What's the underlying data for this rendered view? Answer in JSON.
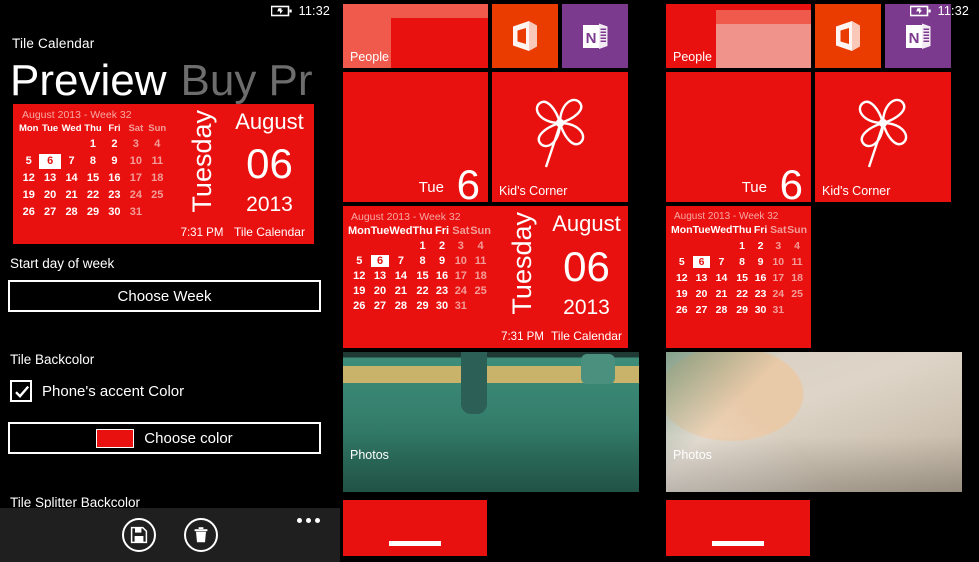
{
  "status_bar": {
    "time": "11:32",
    "battery_icon": "battery-charging-icon"
  },
  "app": {
    "title": "Tile Calendar",
    "pivot": {
      "active": "Preview",
      "inactive": "Buy Pr"
    },
    "settings": {
      "start_day_label": "Start day of week",
      "choose_week_button": "Choose Week",
      "tile_backcolor_label": "Tile Backcolor",
      "accent_checkbox_label": "Phone's accent Color",
      "accent_checked": true,
      "choose_color_button": "Choose color",
      "choose_color_swatch": "#e8110f",
      "tile_splitter_label": "Tile Splitter Backcolor"
    },
    "appbar": {
      "save_icon": "save-floppy-icon",
      "delete_icon": "trash-can-icon",
      "more_icon": "ellipsis-icon"
    }
  },
  "calendar_tile": {
    "month_header": "August 2013 - Week 32",
    "day_names": [
      "Mon",
      "Tue",
      "Wed",
      "Thu",
      "Fri",
      "Sat",
      "Sun"
    ],
    "weekend_indices": [
      5,
      6
    ],
    "weeks": [
      [
        "",
        "",
        "",
        "1",
        "2",
        "3",
        "4"
      ],
      [
        "5",
        "6",
        "7",
        "8",
        "9",
        "10",
        "11"
      ],
      [
        "12",
        "13",
        "14",
        "15",
        "16",
        "17",
        "18"
      ],
      [
        "19",
        "20",
        "21",
        "22",
        "23",
        "24",
        "25"
      ],
      [
        "26",
        "27",
        "28",
        "29",
        "30",
        "31",
        ""
      ]
    ],
    "today": "6",
    "weekday": "Tuesday",
    "time": "7:31 PM",
    "month_name": "August",
    "day_number": "06",
    "year": "2013",
    "app_name": "Tile Calendar",
    "backcolor": "#e8110f"
  },
  "start_screen_1": {
    "tiles": [
      {
        "name": "people",
        "label": "People",
        "color": "#ef5a4d"
      },
      {
        "name": "office",
        "label": "",
        "color": "#ea3c00",
        "icon": "office-logo-icon"
      },
      {
        "name": "onenote",
        "label": "",
        "color": "#7c3a8e",
        "icon": "onenote-logo-icon"
      },
      {
        "name": "calendar-date",
        "label": "",
        "dow": "Tue",
        "day": "6",
        "color": "#e8110f"
      },
      {
        "name": "kids-corner",
        "label": "Kid's Corner",
        "color": "#e8110f",
        "icon": "pinwheel-icon"
      },
      {
        "name": "tile-calendar-live",
        "label": "",
        "color": "#e8110f"
      },
      {
        "name": "photos",
        "label": "Photos",
        "color": "#3f8f7b"
      },
      {
        "name": "partial-red",
        "label": "",
        "color": "#e8110f"
      }
    ]
  },
  "start_screen_2": {
    "tiles": [
      {
        "name": "people",
        "label": "People",
        "color": "#e8110f"
      },
      {
        "name": "office",
        "label": "",
        "color": "#ea3c00",
        "icon": "office-logo-icon"
      },
      {
        "name": "onenote",
        "label": "",
        "color": "#7c3a8e",
        "icon": "onenote-logo-icon"
      },
      {
        "name": "calendar-date",
        "label": "",
        "dow": "Tue",
        "day": "6",
        "color": "#e8110f"
      },
      {
        "name": "kids-corner",
        "label": "Kid's Corner",
        "color": "#e8110f",
        "icon": "pinwheel-icon"
      },
      {
        "name": "tile-calendar-live",
        "label": "",
        "color": "#e8110f"
      },
      {
        "name": "photos",
        "label": "Photos",
        "color": "#d8cfc2"
      },
      {
        "name": "partial-red",
        "label": "",
        "color": "#e8110f"
      }
    ]
  }
}
